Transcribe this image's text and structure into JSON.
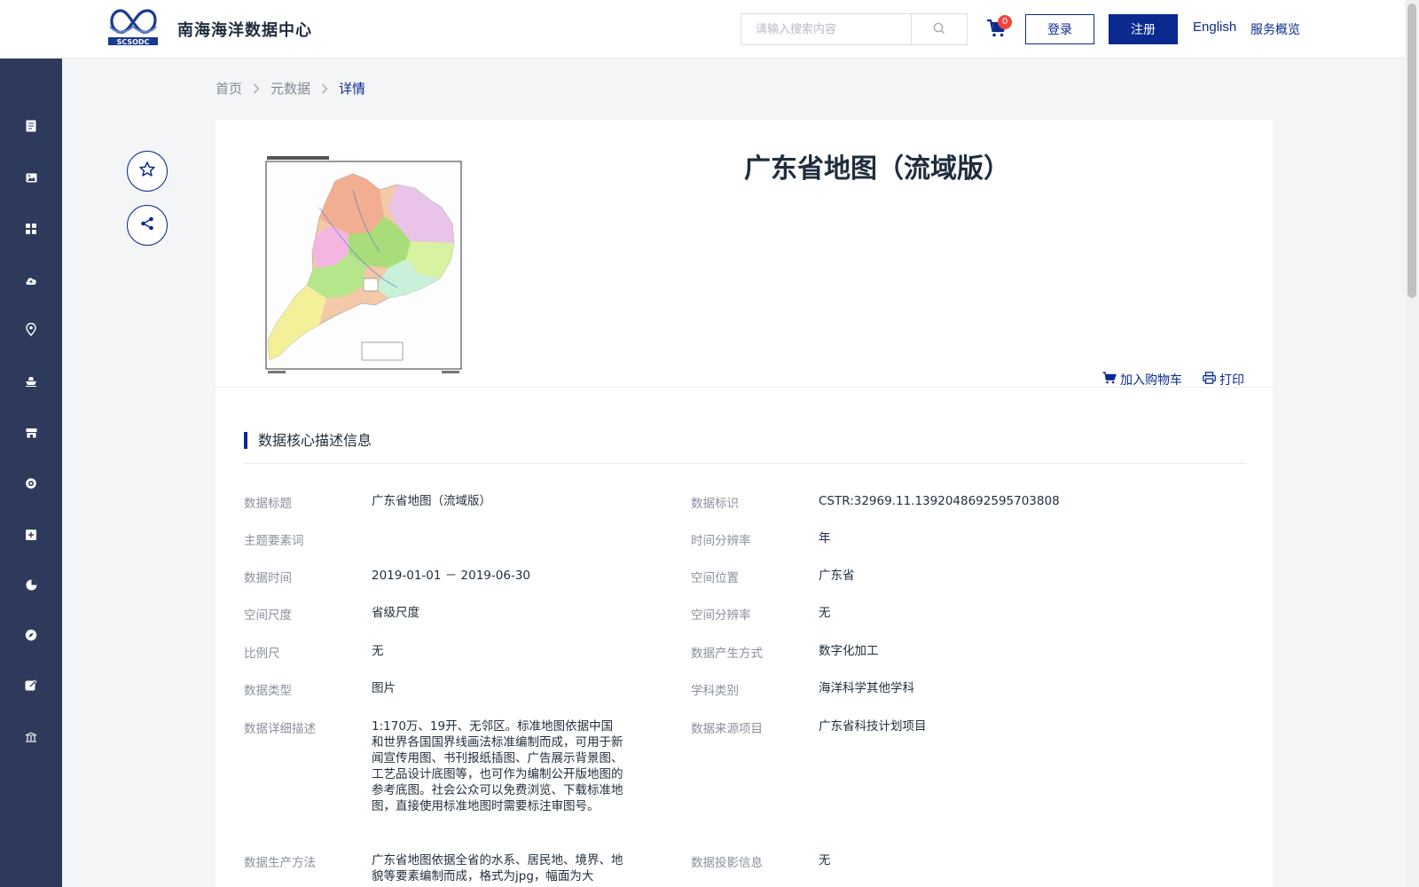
{
  "header": {
    "site_title": "南海海洋数据中心",
    "search_placeholder": "请输入搜索内容",
    "cart_count": "0",
    "login_label": "登录",
    "register_label": "注册",
    "lang_label": "English",
    "service_label": "服务概览"
  },
  "colors": {
    "primary": "#0b2a8f",
    "sidebar": "#2d3a5c",
    "badge": "#f0443d"
  },
  "sidebar": {
    "items": [
      {
        "icon": "document-icon"
      },
      {
        "icon": "image-icon"
      },
      {
        "icon": "grid-icon"
      },
      {
        "icon": "cloud-upload-icon"
      },
      {
        "icon": "location-pin-icon"
      },
      {
        "icon": "ship-icon"
      },
      {
        "icon": "store-icon"
      },
      {
        "icon": "target-icon"
      },
      {
        "icon": "plus-box-icon"
      },
      {
        "icon": "pie-chart-icon"
      },
      {
        "icon": "compass-icon"
      },
      {
        "icon": "edit-icon"
      },
      {
        "icon": "building-icon"
      }
    ]
  },
  "breadcrumb": {
    "home": "首页",
    "metadata": "元数据",
    "current": "详情"
  },
  "dataset": {
    "title": "广东省地图（流域版）",
    "add_to_cart": "加入购物车",
    "print": "打印"
  },
  "section": {
    "title": "数据核心描述信息"
  },
  "info": {
    "left": [
      {
        "label": "数据标题",
        "value": "广东省地图（流域版）"
      },
      {
        "label": "主题要素词",
        "value": ""
      },
      {
        "label": "数据时间",
        "value": "2019-01-01 － 2019-06-30"
      },
      {
        "label": "空间尺度",
        "value": "省级尺度"
      },
      {
        "label": "比例尺",
        "value": "无"
      },
      {
        "label": "数据类型",
        "value": "图片"
      },
      {
        "label": "数据详细描述",
        "value": "1:170万、19开、无邻区。标准地图依据中国和世界各国国界线画法标准编制而成，可用于新闻宣传用图、书刊报纸插图、广告展示背景图、工艺品设计底图等，也可作为编制公开版地图的参考底图。社会公众可以免费浏览、下载标准地图，直接使用标准地图时需要标注审图号。"
      },
      {
        "label": "数据生产方法",
        "value": "广东省地图依据全省的水系、居民地、境界、地貌等要素编制而成，格式为jpg，幅面为大"
      }
    ],
    "right": [
      {
        "label": "数据标识",
        "value": "CSTR:32969.11.1392048692595703808"
      },
      {
        "label": "时间分辨率",
        "value": "年"
      },
      {
        "label": "空间位置",
        "value": "广东省"
      },
      {
        "label": "空间分辨率",
        "value": "无"
      },
      {
        "label": "数据产生方式",
        "value": "数字化加工"
      },
      {
        "label": "学科类别",
        "value": "海洋科学其他学科"
      },
      {
        "label": "数据来源项目",
        "value": "广东省科技计划项目"
      },
      {
        "label": "数据投影信息",
        "value": "无"
      }
    ]
  }
}
